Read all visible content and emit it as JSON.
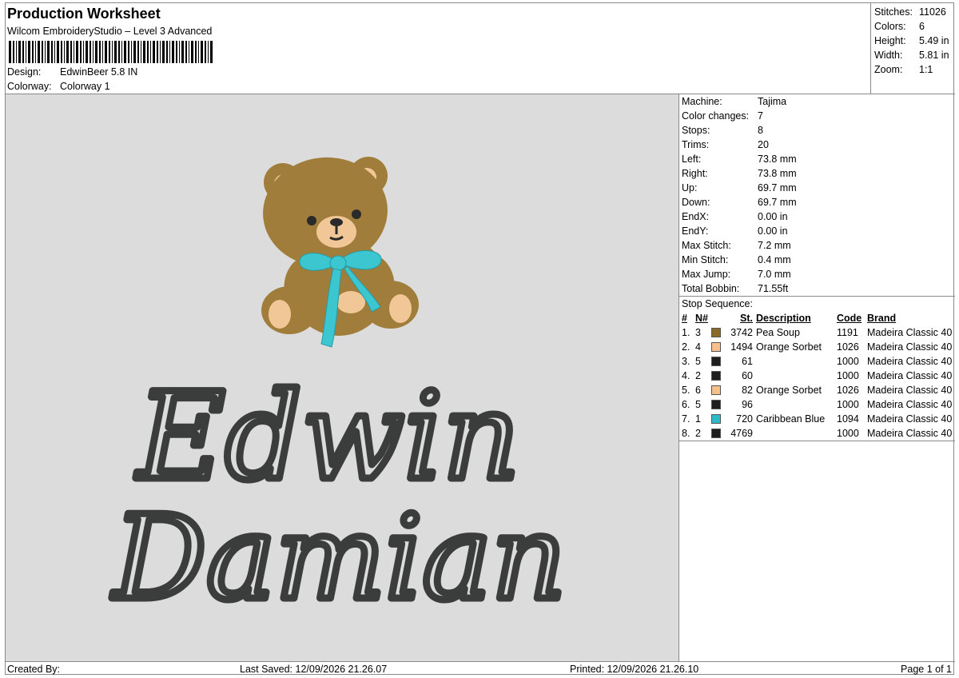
{
  "header": {
    "title": "Production Worksheet",
    "subtitle": "Wilcom EmbroideryStudio – Level 3 Advanced",
    "design_label": "Design:",
    "design_value": "EdwinBeer 5.8 IN",
    "colorway_label": "Colorway:",
    "colorway_value": "Colorway 1"
  },
  "stats": [
    {
      "label": "Stitches:",
      "value": "11026"
    },
    {
      "label": "Colors:",
      "value": "6"
    },
    {
      "label": "Height:",
      "value": "5.49 in"
    },
    {
      "label": "Width:",
      "value": "5.81 in"
    },
    {
      "label": "Zoom:",
      "value": "1:1"
    }
  ],
  "machine_info": [
    {
      "label": "Machine:",
      "value": "Tajima"
    },
    {
      "label": "Color changes:",
      "value": "7"
    },
    {
      "label": "Stops:",
      "value": "8"
    },
    {
      "label": "Trims:",
      "value": "20"
    },
    {
      "label": "Left:",
      "value": "73.8 mm"
    },
    {
      "label": "Right:",
      "value": "73.8 mm"
    },
    {
      "label": "Up:",
      "value": "69.7 mm"
    },
    {
      "label": "Down:",
      "value": "69.7 mm"
    },
    {
      "label": "EndX:",
      "value": "0.00 in"
    },
    {
      "label": "EndY:",
      "value": "0.00 in"
    },
    {
      "label": "Max Stitch:",
      "value": "7.2 mm"
    },
    {
      "label": "Min Stitch:",
      "value": "0.4 mm"
    },
    {
      "label": "Max Jump:",
      "value": "7.0 mm"
    },
    {
      "label": "Total Bobbin:",
      "value": "71.55ft"
    }
  ],
  "stop_sequence": {
    "title": "Stop Sequence:",
    "columns": {
      "idx": "#",
      "n": "N#",
      "st": "St.",
      "desc": "Description",
      "code": "Code",
      "brand": "Brand"
    },
    "rows": [
      {
        "idx": "1.",
        "n": "3",
        "color": "#8a6a2a",
        "st": "3742",
        "desc": "Pea Soup",
        "code": "1191",
        "brand": "Madeira Classic 40"
      },
      {
        "idx": "2.",
        "n": "4",
        "color": "#f7c08c",
        "st": "1494",
        "desc": "Orange Sorbet",
        "code": "1026",
        "brand": "Madeira Classic 40"
      },
      {
        "idx": "3.",
        "n": "5",
        "color": "#1e1e1e",
        "st": "61",
        "desc": "",
        "code": "1000",
        "brand": "Madeira Classic 40"
      },
      {
        "idx": "4.",
        "n": "2",
        "color": "#1e1e1e",
        "st": "60",
        "desc": "",
        "code": "1000",
        "brand": "Madeira Classic 40"
      },
      {
        "idx": "5.",
        "n": "6",
        "color": "#f7c08c",
        "st": "82",
        "desc": "Orange Sorbet",
        "code": "1026",
        "brand": "Madeira Classic 40"
      },
      {
        "idx": "6.",
        "n": "5",
        "color": "#1e1e1e",
        "st": "96",
        "desc": "",
        "code": "1000",
        "brand": "Madeira Classic 40"
      },
      {
        "idx": "7.",
        "n": "1",
        "color": "#2fb8c8",
        "st": "720",
        "desc": "Caribbean Blue",
        "code": "1094",
        "brand": "Madeira Classic 40"
      },
      {
        "idx": "8.",
        "n": "2",
        "color": "#1e1e1e",
        "st": "4769",
        "desc": "",
        "code": "1000",
        "brand": "Madeira Classic 40"
      }
    ]
  },
  "design_preview": {
    "text_line_1": "Edwin",
    "text_line_2": "Damian",
    "colors": {
      "background": "#dcdcdc",
      "bear_fur": "#a07d3a",
      "bear_muzzle": "#f2c797",
      "bear_dark": "#2a2a2a",
      "ribbon": "#3cc6d0",
      "lettering": "#3a3d3c"
    }
  },
  "footer": {
    "created_by": "Created By:",
    "last_saved": "Last Saved: 12/09/2026 21.26.07",
    "printed": "Printed: 12/09/2026 21.26.10",
    "page": "Page 1 of 1"
  }
}
